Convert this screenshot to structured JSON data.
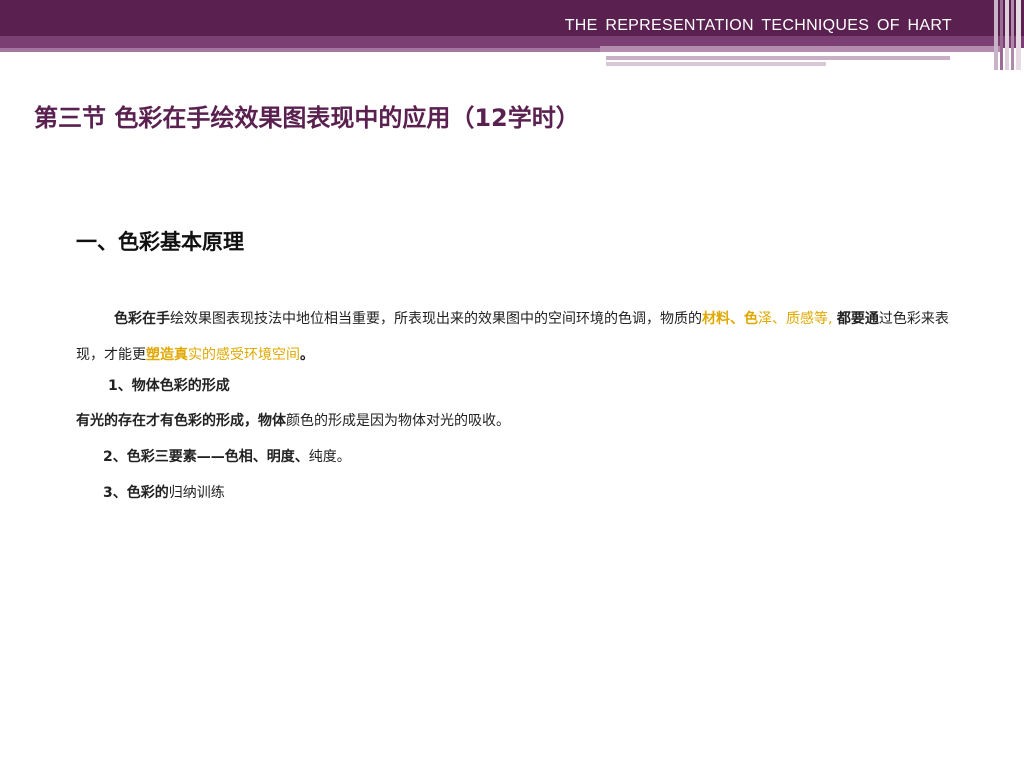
{
  "header": {
    "title": "THE  REPRESENTATION  TECHNIQUES  OF  HART"
  },
  "slide": {
    "title": "第三节 色彩在手绘效果图表现中的应用（12学时）"
  },
  "section": {
    "heading": "一、色彩基本原理"
  },
  "paragraph": {
    "seg1": "色彩在手",
    "seg2": "绘效果图表现技法中地位相当重要，所表现出来的效果图中的空间环境的色调，物质的",
    "seg3": "材料、色",
    "seg4": "泽、质感等,",
    "seg5": "都要通",
    "seg6": "过色彩来表现，才能更",
    "seg7": "塑造真",
    "seg8": "实的感受环境空间",
    "seg9": "。"
  },
  "item1": {
    "title": "1、物体色彩的形成"
  },
  "item1_text": {
    "bold": "有光的存在才有色彩的形成，物体",
    "rest": "颜色的形成是因为物体对光的吸收。"
  },
  "item2": {
    "bold": "2、色彩三要素——色相、明度、",
    "rest": "纯度。"
  },
  "item3": {
    "bold": "3、色彩的",
    "rest": "归纳训练"
  },
  "colors": {
    "accent": "#5a2150",
    "highlight": "#e0a800"
  }
}
